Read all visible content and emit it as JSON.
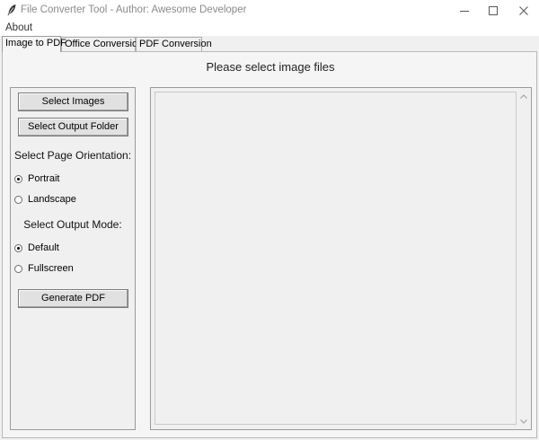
{
  "window": {
    "title": "File Converter Tool - Author: Awesome Developer",
    "app_icon": "feather-icon"
  },
  "menu": {
    "items": [
      {
        "label": "About"
      }
    ]
  },
  "tabs": [
    {
      "label": "Image to PDF",
      "active": true
    },
    {
      "label": "Office Conversion",
      "active": false
    },
    {
      "label": "PDF Conversion",
      "active": false
    }
  ],
  "main": {
    "header": "Please select image files",
    "buttons": {
      "select_images": "Select Images",
      "select_output_folder": "Select Output Folder",
      "generate_pdf": "Generate PDF"
    },
    "orientation": {
      "label": "Select Page Orientation:",
      "options": [
        "Portrait",
        "Landscape"
      ],
      "selected": "Portrait"
    },
    "output_mode": {
      "label": "Select Output Mode:",
      "options": [
        "Default",
        "Fullscreen"
      ],
      "selected": "Default"
    }
  }
}
